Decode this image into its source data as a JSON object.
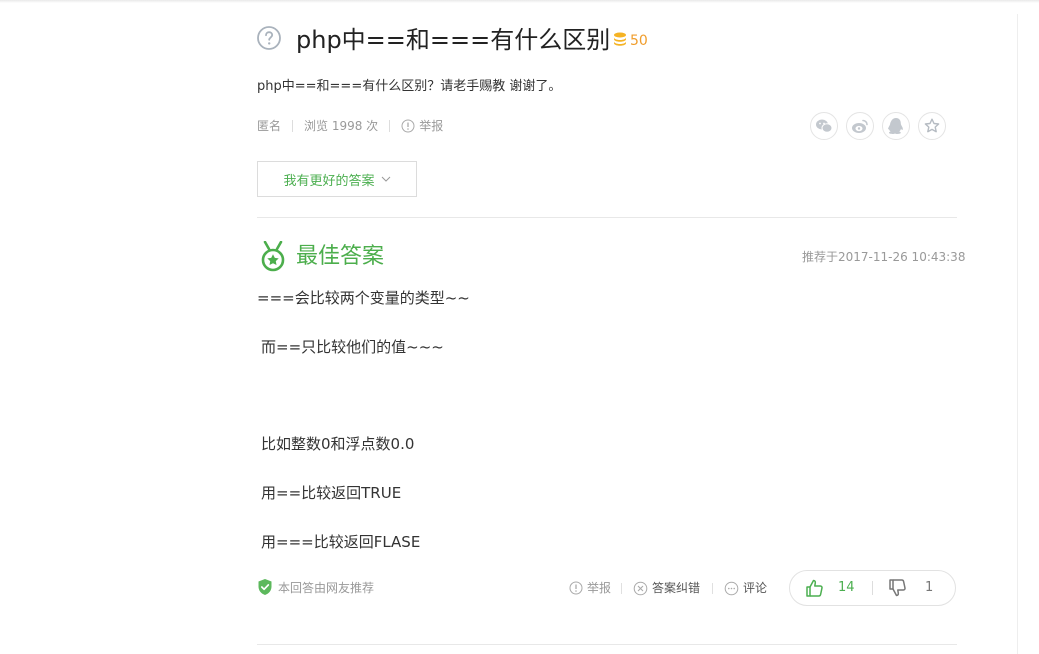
{
  "question": {
    "title": "php中==和===有什么区别",
    "reward": "50",
    "description": "php中==和===有什么区别？请老手赐教 谢谢了。",
    "author": "匿名",
    "views": "浏览 1998 次",
    "report": "举报",
    "better_answer_button": "我有更好的答案"
  },
  "share_icons": [
    "wechat-icon",
    "weibo-icon",
    "qq-icon",
    "favorite-star-icon"
  ],
  "best_answer": {
    "heading": "最佳答案",
    "recommended_time": "推荐于2017-11-26 10:43:38",
    "lines": [
      "===会比较两个变量的类型~~",
      " 而==只比较他们的值~~~",
      " 比如整数0和浮点数0.0",
      " 用==比较返回TRUE",
      " 用===比较返回FLASE"
    ],
    "recommended_by": "本回答由网友推荐",
    "actions": {
      "report": "举报",
      "correct": "答案纠错",
      "comment": "评论"
    },
    "upvotes": "14",
    "downvotes": "1"
  },
  "colors": {
    "accent_green": "#4cae4c",
    "reward_orange": "#f09d2c",
    "muted_gray": "#999999"
  }
}
